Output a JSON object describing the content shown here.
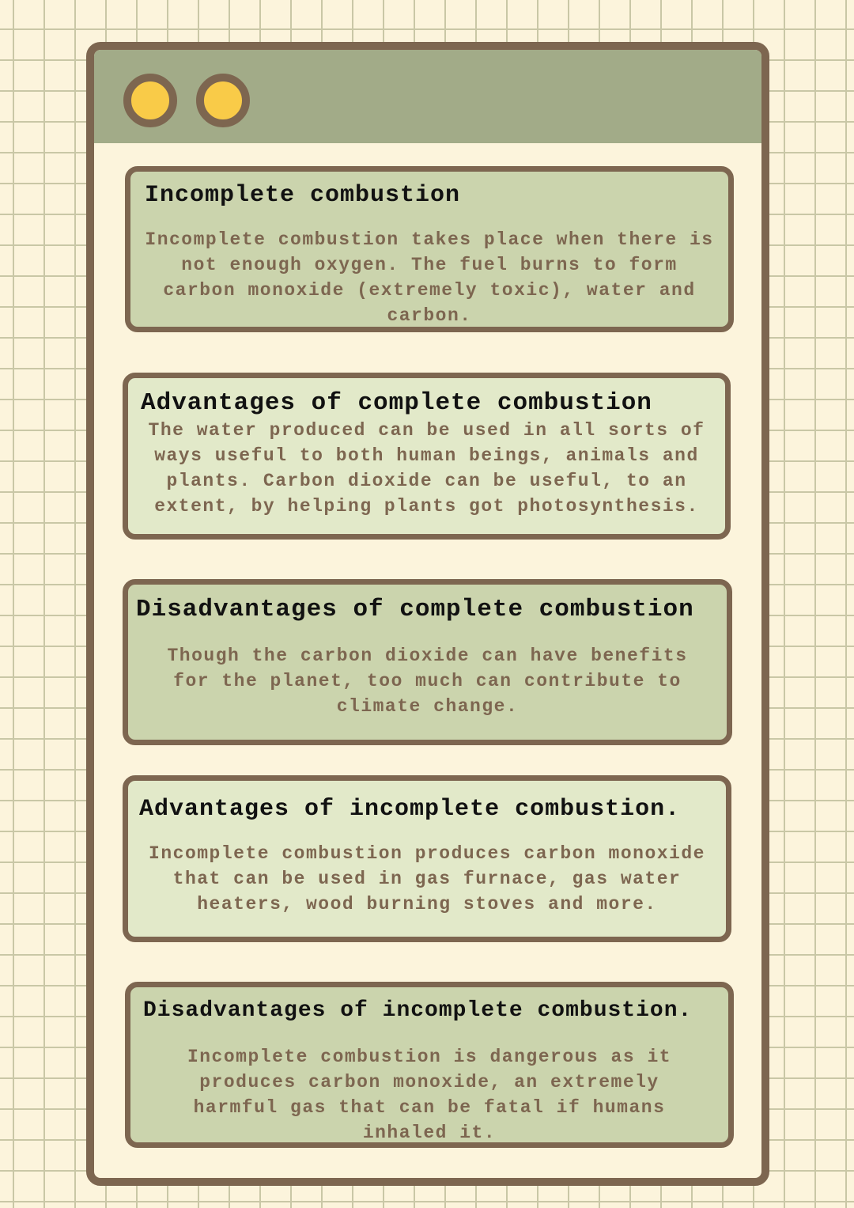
{
  "window": {
    "titlebar_buttons": [
      {
        "name": "yellow-dot-1",
        "color": "#f9cb48"
      },
      {
        "name": "yellow-dot-2",
        "color": "#f9cb48"
      }
    ]
  },
  "colors": {
    "background": "#fcf4dc",
    "grid": "#c9c7a6",
    "frame": "#7d6650",
    "titlebar": "#a2ab88",
    "card_dark": "#cbd4ad",
    "card_light": "#e2e9c9",
    "title_text": "#111111",
    "body_text": "#7d6650",
    "dot": "#f9cb48"
  },
  "cards": [
    {
      "title": "Incomplete combustion",
      "body": "Incomplete combustion takes place when there is not enough oxygen. The fuel burns to form carbon monoxide (extremely toxic), water and carbon."
    },
    {
      "title": "Advantages of complete combustion",
      "body": "The water produced can be used in all sorts of ways useful to both human beings, animals and plants. Carbon dioxide can be useful, to an extent, by helping plants got photosynthesis."
    },
    {
      "title": "Disadvantages of complete combustion",
      "body": "Though the carbon dioxide can have benefits for the planet, too much can contribute to climate change."
    },
    {
      "title": "Advantages of incomplete combustion.",
      "body": "Incomplete combustion produces carbon monoxide that can be used in gas furnace, gas water heaters, wood burning stoves and more."
    },
    {
      "title": "Disadvantages of incomplete combustion.",
      "body": "Incomplete combustion is dangerous as it produces carbon monoxide, an extremely harmful gas that can be fatal if humans inhaled it."
    }
  ]
}
